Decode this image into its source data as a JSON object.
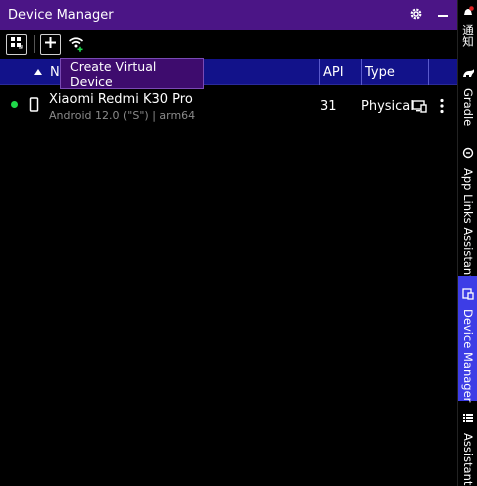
{
  "window": {
    "title": "Device Manager"
  },
  "titlebar": {
    "icons": [
      "gear-icon",
      "minimize-icon"
    ]
  },
  "toolbar": {
    "buttons": [
      "device-grid-icon",
      "add-icon",
      "wifi-pair-icon"
    ]
  },
  "tooltip": {
    "text": "Create Virtual Device"
  },
  "table": {
    "columns": {
      "name": "N",
      "api": "API",
      "type": "Type"
    },
    "sort_icon": "sort-ascending-icon",
    "rows": [
      {
        "status": "online",
        "status_color": "#1fd84a",
        "icon": "phone-icon",
        "name": "Xiaomi Redmi K30 Pro",
        "details": "Android 12.0 (\"S\") | arm64",
        "api": "31",
        "type": "Physical",
        "actions": [
          "device-mirror-icon",
          "more-vertical-icon"
        ]
      }
    ]
  },
  "sidebar": {
    "items": [
      {
        "label": "通知",
        "icon": "notification-bell-icon"
      },
      {
        "label": "Gradle",
        "icon": "gradle-icon"
      },
      {
        "label": "App Links Assistant",
        "icon": "link-icon"
      },
      {
        "label": "Device Manager",
        "icon": "device-manager-icon",
        "active": true
      },
      {
        "label": "Assistant",
        "icon": "list-icon"
      }
    ]
  },
  "colors": {
    "title_bar": "#4b1586",
    "table_header": "#12128a",
    "tooltip": "#3e0c6e",
    "active_side_tab": "#3d3de6",
    "status_online": "#1fd84a"
  }
}
